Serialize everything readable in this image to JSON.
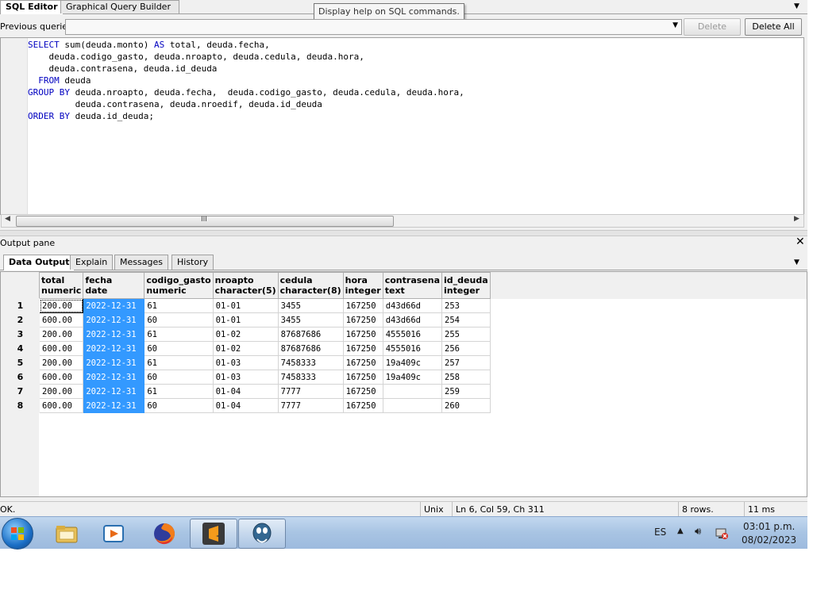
{
  "top_tabs": [
    {
      "label": "SQL Editor",
      "active": true
    },
    {
      "label": "Graphical Query Builder",
      "active": false
    }
  ],
  "tooltip": "Display help on SQL commands.",
  "previous_queries": {
    "label": "Previous queries",
    "value": ""
  },
  "buttons": {
    "delete": "Delete",
    "delete_all": "Delete All"
  },
  "sql_lines": [
    "SELECT sum(deuda.monto) AS total, deuda.fecha,",
    "    deuda.codigo_gasto, deuda.nroapto, deuda.cedula, deuda.hora,",
    "    deuda.contrasena, deuda.id_deuda",
    "  FROM deuda",
    "GROUP BY deuda.nroapto, deuda.fecha,  deuda.codigo_gasto, deuda.cedula, deuda.hora,",
    "         deuda.contrasena, deuda.nroedif, deuda.id_deuda",
    "ORDER BY deuda.id_deuda;"
  ],
  "output_pane": {
    "title": "Output pane",
    "tabs": [
      {
        "label": "Data Output",
        "active": true
      },
      {
        "label": "Explain",
        "active": false
      },
      {
        "label": "Messages",
        "active": false
      },
      {
        "label": "History",
        "active": false
      }
    ],
    "columns": [
      {
        "name": "total",
        "type": "numeric"
      },
      {
        "name": "fecha",
        "type": "date"
      },
      {
        "name": "codigo_gasto",
        "type": "numeric"
      },
      {
        "name": "nroapto",
        "type": "character(5)"
      },
      {
        "name": "cedula",
        "type": "character(8)"
      },
      {
        "name": "hora",
        "type": "integer"
      },
      {
        "name": "contrasena",
        "type": "text"
      },
      {
        "name": "id_deuda",
        "type": "integer"
      }
    ],
    "rows": [
      {
        "num": "1",
        "cells": [
          "200.00",
          "2022-12-31",
          "61",
          "01-01",
          "3455",
          "167250",
          "d43d66d",
          "253"
        ]
      },
      {
        "num": "2",
        "cells": [
          "600.00",
          "2022-12-31",
          "60",
          "01-01",
          "3455",
          "167250",
          "d43d66d",
          "254"
        ]
      },
      {
        "num": "3",
        "cells": [
          "200.00",
          "2022-12-31",
          "61",
          "01-02",
          "87687686",
          "167250",
          "4555016",
          "255"
        ]
      },
      {
        "num": "4",
        "cells": [
          "600.00",
          "2022-12-31",
          "60",
          "01-02",
          "87687686",
          "167250",
          "4555016",
          "256"
        ]
      },
      {
        "num": "5",
        "cells": [
          "200.00",
          "2022-12-31",
          "61",
          "01-03",
          "7458333",
          "167250",
          "19a409c",
          "257"
        ]
      },
      {
        "num": "6",
        "cells": [
          "600.00",
          "2022-12-31",
          "60",
          "01-03",
          "7458333",
          "167250",
          "19a409c",
          "258"
        ]
      },
      {
        "num": "7",
        "cells": [
          "200.00",
          "2022-12-31",
          "61",
          "01-04",
          "7777",
          "167250",
          "",
          "259"
        ]
      },
      {
        "num": "8",
        "cells": [
          "600.00",
          "2022-12-31",
          "60",
          "01-04",
          "7777",
          "167250",
          "",
          "260"
        ]
      }
    ],
    "selected_column": 1
  },
  "status_bar": {
    "message": "OK.",
    "line_ending": "Unix",
    "position": "Ln 6, Col 59, Ch 311",
    "rows": "8 rows.",
    "time": "11 ms"
  },
  "taskbar": {
    "apps": [
      "explorer-icon",
      "media-player-icon",
      "firefox-icon",
      "sublime-text-icon",
      "pgadmin-icon"
    ],
    "language": "ES",
    "time": "03:01 p.m.",
    "date": "08/02/2023"
  },
  "colors": {
    "selection": "#3399ff",
    "keyword": "#0000c0",
    "taskbar": "#a8c4e3"
  }
}
